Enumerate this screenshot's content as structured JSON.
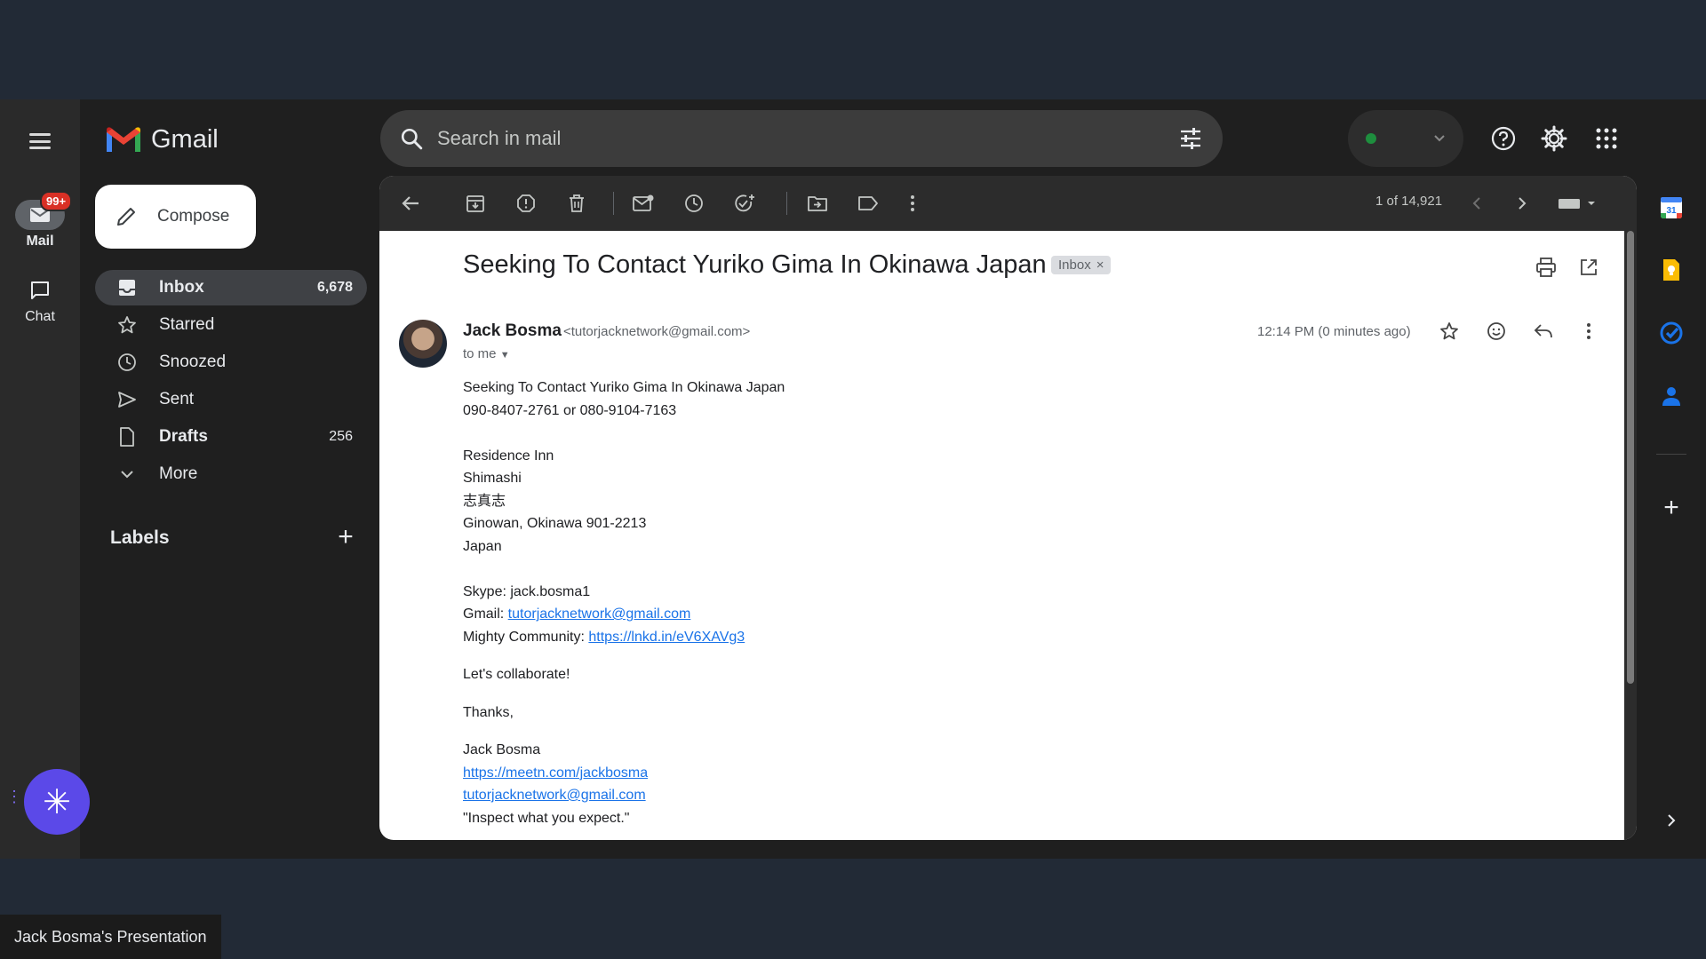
{
  "app": {
    "name": "Gmail"
  },
  "rail": {
    "mail_label": "Mail",
    "mail_badge": "99+",
    "chat_label": "Chat"
  },
  "search": {
    "placeholder": "Search in mail"
  },
  "nav": {
    "compose_label": "Compose",
    "items": [
      {
        "label": "Inbox",
        "count": "6,678",
        "icon": "inbox-icon"
      },
      {
        "label": "Starred",
        "count": "",
        "icon": "star-icon"
      },
      {
        "label": "Snoozed",
        "count": "",
        "icon": "clock-icon"
      },
      {
        "label": "Sent",
        "count": "",
        "icon": "send-icon"
      },
      {
        "label": "Drafts",
        "count": "256",
        "icon": "draft-icon"
      },
      {
        "label": "More",
        "count": "",
        "icon": "chevron-down-icon"
      }
    ],
    "labels_header": "Labels"
  },
  "toolbar": {
    "pager": "1 of 14,921"
  },
  "message": {
    "subject": "Seeking To Contact Yuriko Gima In Okinawa Japan",
    "chip_label": "Inbox",
    "sender_name": "Jack Bosma",
    "sender_email": "<tutorjacknetwork@gmail.com>",
    "to": "to me",
    "time": "12:14 PM (0 minutes ago)",
    "body": {
      "line1": "Seeking To Contact Yuriko Gima In Okinawa Japan",
      "line2": "090-8407-2761 or 080-9104-7163",
      "addr1": "Residence Inn",
      "addr2": "Shimashi",
      "addr3": "志真志",
      "addr4": "Ginowan, Okinawa 901-2213",
      "addr5": "Japan",
      "skype": "Skype: jack.bosma1",
      "gmail_label": "Gmail: ",
      "gmail_link": "tutorjacknetwork@gmail.com",
      "mighty_label": "Mighty Community: ",
      "mighty_link": "https://lnkd.in/eV6XAVg3",
      "collab": "Let's collaborate!",
      "thanks": "Thanks,",
      "sig_name": "Jack Bosma",
      "sig_link1": "https://meetn.com/jackbosma",
      "sig_link2": "tutorjacknetwork@gmail.com",
      "sig_quote": "\"Inspect what you expect.\""
    }
  },
  "addons": {
    "calendar_day": "31"
  },
  "presenter": {
    "label": "Jack Bosma's Presentation"
  },
  "colors": {
    "accent": "#1a73e8",
    "badge": "#d93025",
    "fab": "#5b49e8"
  }
}
